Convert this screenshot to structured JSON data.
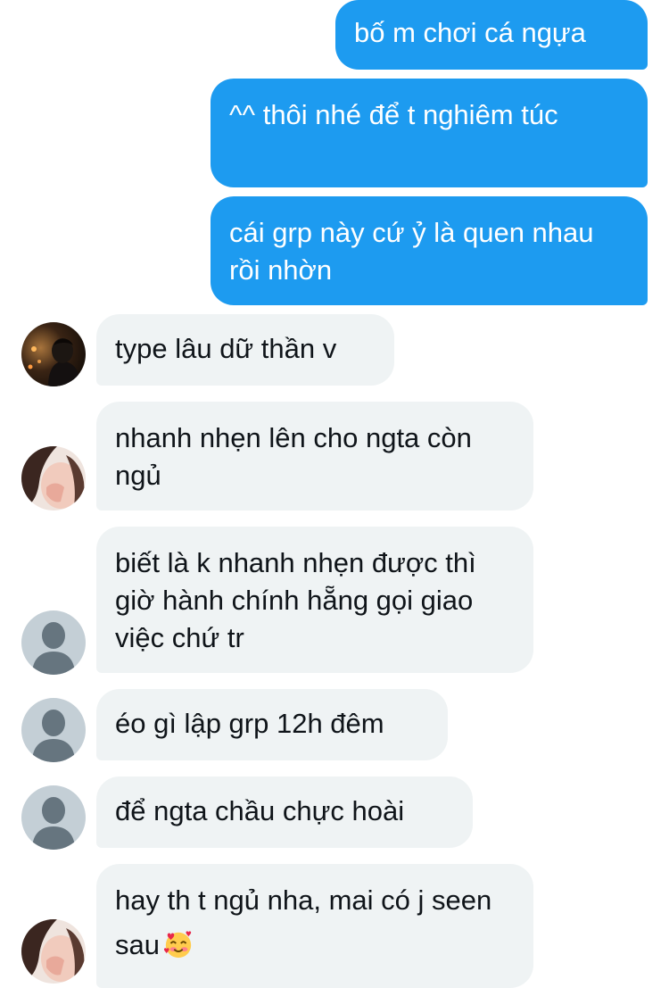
{
  "messages": [
    {
      "sender": "me",
      "text": "bố m chơi cá ngựa"
    },
    {
      "sender": "me",
      "text": "^^ thôi nhé để t nghiêm túc"
    },
    {
      "sender": "me",
      "text": "cái grp này cứ ỷ là quen nhau rồi nhờn"
    },
    {
      "sender": "user-dark-photo",
      "text": "type lâu dữ thần v"
    },
    {
      "sender": "user-girl-photo",
      "text": "nhanh nhẹn lên cho ngta còn ngủ"
    },
    {
      "sender": "user-default",
      "text": "biết là k nhanh nhẹn được thì giờ hành chính hẵng gọi giao việc chứ tr"
    },
    {
      "sender": "user-default",
      "text": "éo gì lập grp 12h đêm"
    },
    {
      "sender": "user-default",
      "text": "để ngta chầu chực hoài"
    },
    {
      "sender": "user-girl-photo",
      "text": "hay th t ngủ nha, mai có j seen sau",
      "emoji": "smiling-face-with-hearts"
    }
  ],
  "colors": {
    "outgoing_bubble": "#1d9bf0",
    "incoming_bubble": "#eff3f4",
    "incoming_text": "#0f1419",
    "default_avatar_bg": "#c4cfd6",
    "default_avatar_figure": "#66757f"
  }
}
